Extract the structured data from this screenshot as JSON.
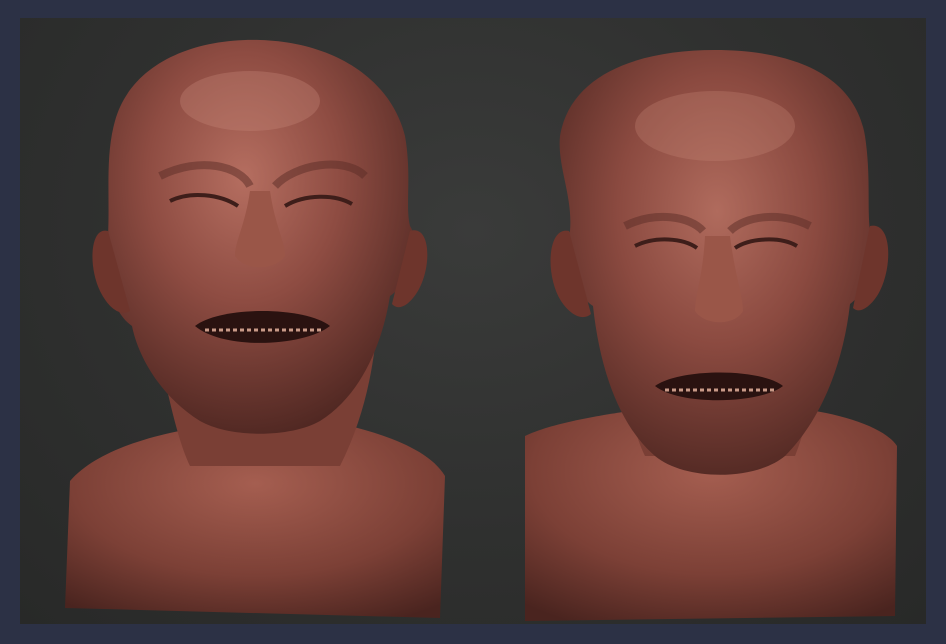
{
  "scene": {
    "description_free": true,
    "renders": [
      {
        "view": "bust-left",
        "icon": "sculpted-head-render"
      },
      {
        "view": "bust-right",
        "icon": "sculpted-head-render"
      }
    ],
    "colors": {
      "border": "#2c3145",
      "background": "#303130",
      "clay": "#8a4a40",
      "clay_highlight": "#c07a6c",
      "clay_shadow": "#3e1e1a"
    }
  }
}
